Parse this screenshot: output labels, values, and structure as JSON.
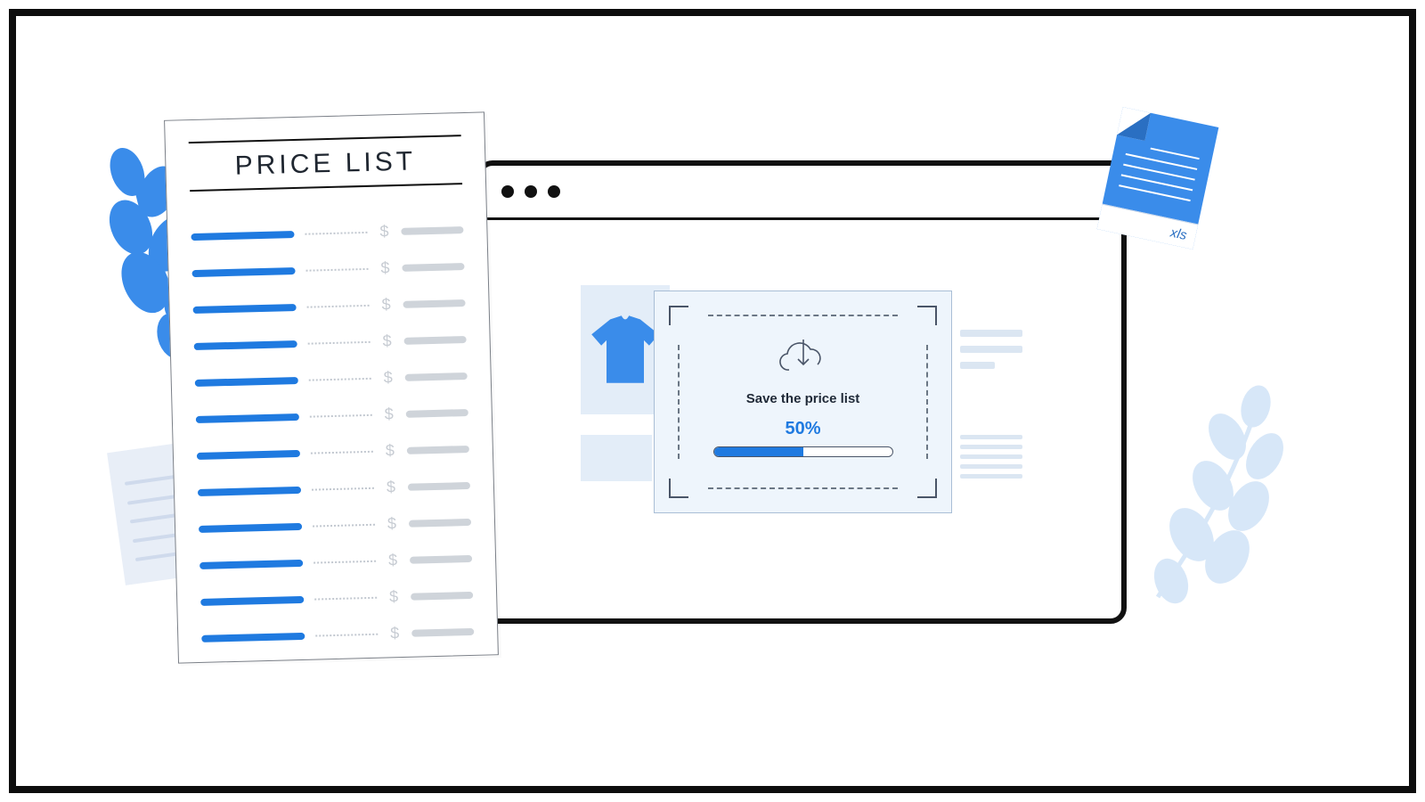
{
  "price_list": {
    "title": "PRICE LIST",
    "currency_symbol": "$",
    "row_count": 12
  },
  "dialog": {
    "title": "Save the price list",
    "percent_label": "50%",
    "progress_pct": 50
  },
  "file_icon": {
    "extension": "xls"
  },
  "colors": {
    "accent": "#1f7ae0",
    "outline": "#111111",
    "panel": "#eef5fc"
  }
}
